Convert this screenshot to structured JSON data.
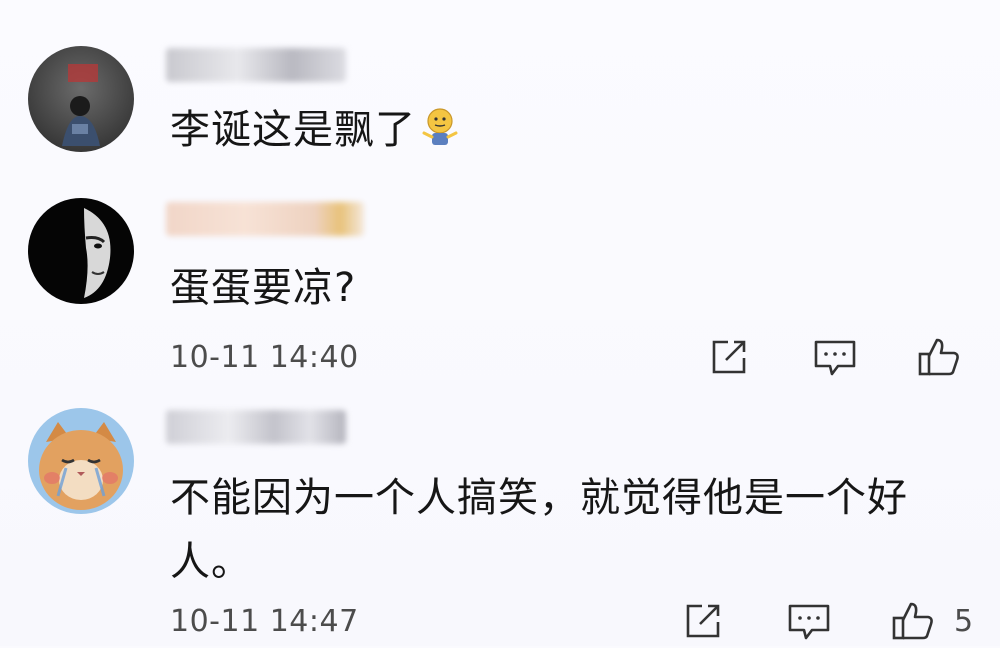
{
  "comments": [
    {
      "text": "李诞这是飘了",
      "emoji_icon": "shrug-emoji-icon"
    },
    {
      "text": "蛋蛋要凉?",
      "timestamp": "10-11 14:40",
      "like_count": ""
    },
    {
      "text_line1": "不能因为一个人搞笑，就觉得他是一个好",
      "text_line2": "人。",
      "timestamp": "10-11 14:47",
      "like_count": "5"
    }
  ],
  "icons": {
    "share": "share-icon",
    "reply": "reply-icon",
    "like": "thumbs-up-icon"
  },
  "colors": {
    "background": "#fafafe",
    "text": "#161616",
    "meta": "#4c4c4c",
    "icon": "#333333"
  }
}
